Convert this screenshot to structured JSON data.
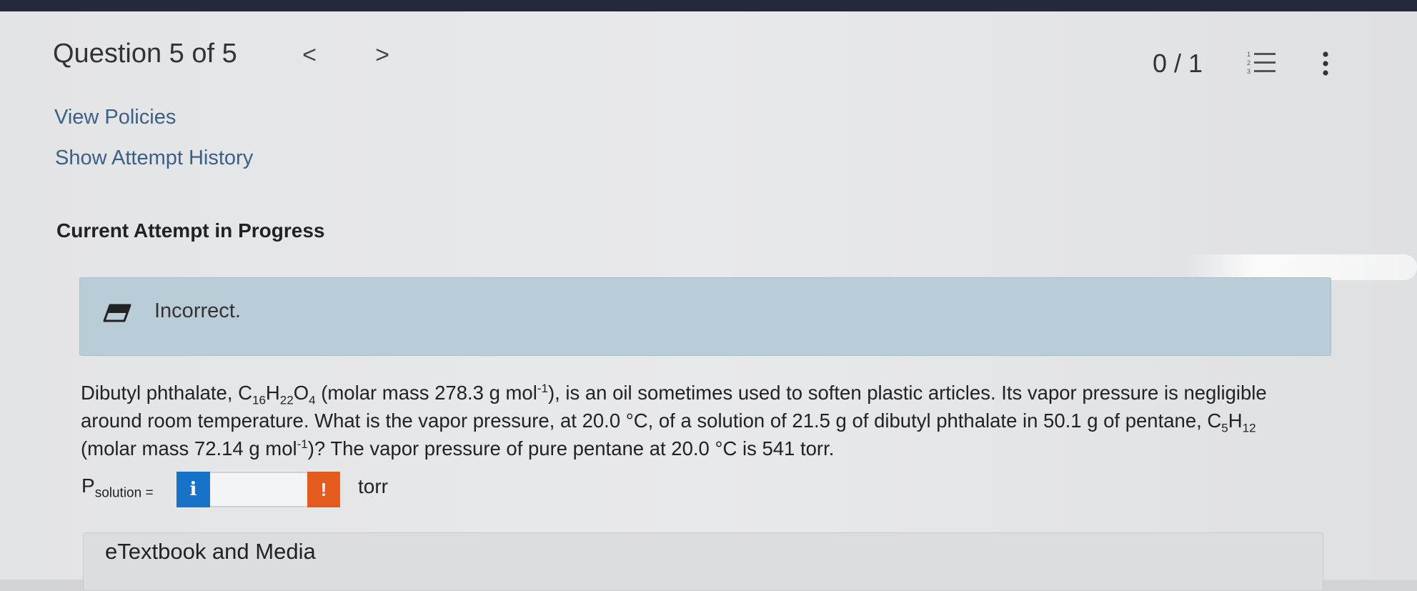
{
  "header": {
    "question_label": "Question 5 of 5",
    "prev_glyph": "<",
    "next_glyph": ">",
    "score": "0 / 1",
    "list_icon": "numbered-list-icon",
    "more_icon": "more-vertical-icon"
  },
  "links": {
    "view_policies": "View Policies",
    "show_attempt_history": "Show Attempt History"
  },
  "attempt_status": "Current Attempt in Progress",
  "feedback": {
    "icon": "eraser-icon",
    "text": "Incorrect.",
    "color": "#b9cdd8"
  },
  "question": {
    "p1": "Dibutyl phthalate, C",
    "s1": "16",
    "p2": "H",
    "s2": "22",
    "p3": "O",
    "s3": "4",
    "p4": " (molar mass 278.3 g mol",
    "sup1": "-1",
    "p5": "), is an oil sometimes used to soften plastic articles. Its vapor pressure is negligible around room temperature. What is the vapor pressure, at 20.0 °C, of a solution of 21.5 g of dibutyl phthalate in 50.1 g of pentane, C",
    "s4": "5",
    "p6": "H",
    "s5": "12",
    "p7": " (molar mass 72.14 g mol",
    "sup2": "-1",
    "p8": ")? The vapor pressure of pure pentane at 20.0 °C is 541 torr."
  },
  "answer": {
    "label_main": "P",
    "label_sub": "solution =",
    "info_glyph": "i",
    "value": "",
    "warning_glyph": "!",
    "unit": "torr",
    "info_color": "#1673c8",
    "warning_color": "#e45b1e"
  },
  "etextbook_label": "eTextbook and Media"
}
